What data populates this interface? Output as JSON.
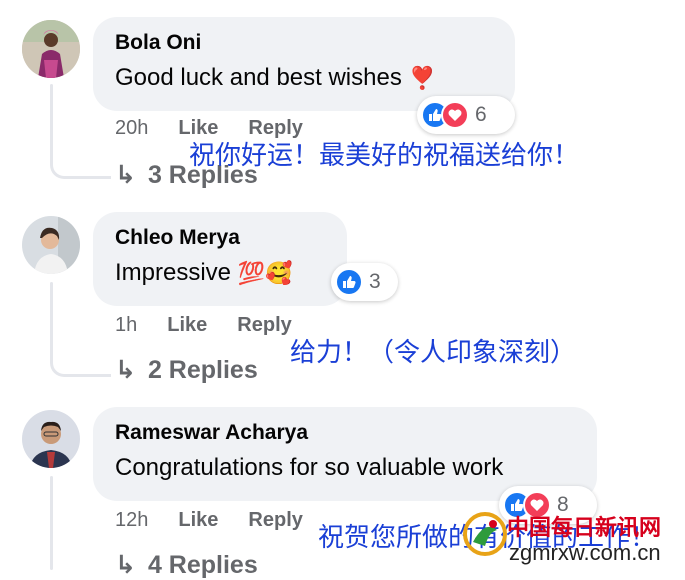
{
  "comments": [
    {
      "author": "Bola Oni",
      "text": "Good luck and best wishes",
      "emoji": "❣️",
      "reaction_count": "6",
      "time": "20h",
      "like_label": "Like",
      "reply_label": "Reply",
      "replies_label": "3 Replies",
      "translation": "祝你好运！最美好的祝福送给你！"
    },
    {
      "author": "Chleo Merya",
      "text": "Impressive",
      "emoji": "💯🥰",
      "reaction_count": "3",
      "time": "1h",
      "like_label": "Like",
      "reply_label": "Reply",
      "replies_label": "2 Replies",
      "translation": "给力！（令人印象深刻）"
    },
    {
      "author": "Rameswar Acharya",
      "text": "Congratulations for so valuable work",
      "emoji": "",
      "reaction_count": "8",
      "time": "12h",
      "like_label": "Like",
      "reply_label": "Reply",
      "replies_label": "4 Replies",
      "translation": "祝贺您所做的有价值的工作！"
    }
  ],
  "icons": {
    "reply_arrow": "↳",
    "like": "thumbs-up-icon",
    "love": "heart-icon"
  },
  "colors": {
    "like": "#1877f2",
    "love": "#f33e58",
    "bubble": "#f0f2f5",
    "meta": "#65676b",
    "overlay_text": "#1a3fd6"
  },
  "watermark": {
    "title": "中国每日新讯网",
    "url": "zgmrxw.com.cn"
  }
}
